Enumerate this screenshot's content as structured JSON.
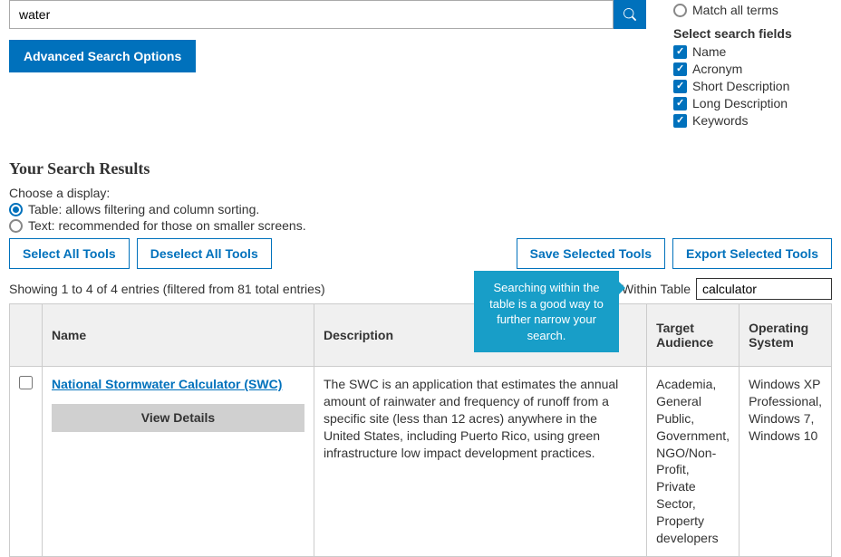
{
  "search": {
    "value": "water",
    "advanced_button": "Advanced Search Options"
  },
  "match": {
    "all_terms": "Match all terms"
  },
  "fields": {
    "heading": "Select search fields",
    "items": [
      "Name",
      "Acronym",
      "Short Description",
      "Long Description",
      "Keywords"
    ]
  },
  "results": {
    "heading": "Your Search Results",
    "display_label": "Choose a display:",
    "display_options": [
      "Table: allows filtering and column sorting.",
      "Text: recommended for those on smaller screens."
    ]
  },
  "actions": {
    "select_all": "Select All Tools",
    "deselect_all": "Deselect All Tools",
    "save_selected": "Save Selected Tools",
    "export_selected": "Export Selected Tools"
  },
  "entries_text": "Showing 1 to 4 of 4 entries (filtered from 81 total entries)",
  "search_within": {
    "label": "Search Within Table",
    "value": "calculator"
  },
  "tooltip": "Searching within the table is a good way to further narrow your search.",
  "table": {
    "headers": {
      "name": "Name",
      "description": "Description",
      "target": "Target Audience",
      "os": "Operating System"
    },
    "row": {
      "tool_name": "National Stormwater Calculator (SWC)",
      "view_details": "View Details",
      "description": "The SWC is an application that estimates the annual amount of rainwater and frequency of runoff from a specific site (less than 12 acres) anywhere in the United States, including Puerto Rico, using green infrastructure low impact development practices.",
      "target": "Academia, General Public, Government, NGO/Non-Profit, Private Sector, Property developers",
      "os": "Windows XP Professional, Windows 7, Windows 10"
    }
  }
}
